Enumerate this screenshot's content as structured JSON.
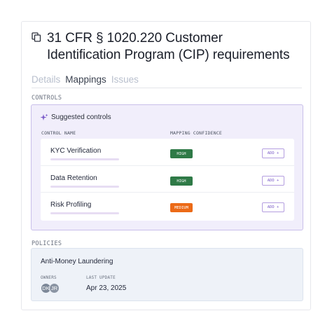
{
  "document": {
    "title": "31 CFR § 1020.220 Customer Identification Program (CIP) requirements",
    "title_icon": "copy-icon"
  },
  "tabs": [
    {
      "label": "Details",
      "active": false
    },
    {
      "label": "Mappings",
      "active": true
    },
    {
      "label": "Issues",
      "active": false
    }
  ],
  "controls": {
    "section_label": "CONTROLS",
    "suggested_title": "Suggested controls",
    "suggested_icon": "sparkle-icon",
    "columns": {
      "name": "CONTROL NAME",
      "confidence": "MAPPING CONFIDENCE"
    },
    "items": [
      {
        "name": "KYC Verification",
        "confidence": "HIGH",
        "confidence_color": "#2f7a47",
        "action": "ADD +"
      },
      {
        "name": "Data Retention",
        "confidence": "HIGH",
        "confidence_color": "#2f7a47",
        "action": "ADD +"
      },
      {
        "name": "Risk Profiling",
        "confidence": "MEDIUM",
        "confidence_color": "#ec6a17",
        "action": "ADD +"
      }
    ]
  },
  "policies": {
    "section_label": "POLICIES",
    "items": [
      {
        "name": "Anti-Money Laundering",
        "owners_label": "OWNERS",
        "owners": [
          {
            "initials": "DK",
            "color": "#7d8898"
          },
          {
            "initials": "JR",
            "color": "#8a94a3"
          }
        ],
        "last_update_label": "LAST UPDATE",
        "last_update": "Apr 23, 2025"
      }
    ]
  },
  "colors": {
    "accent": "#7c5cc9",
    "controls_bg": "#f1eefb",
    "policies_bg": "#eef2f8"
  }
}
